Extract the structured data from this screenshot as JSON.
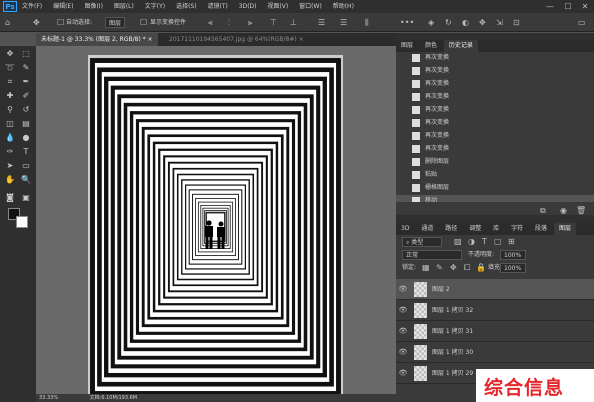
{
  "menubar": {
    "logo": "Ps",
    "items": [
      "文件(F)",
      "编辑(E)",
      "图像(I)",
      "图层(L)",
      "文字(Y)",
      "选择(S)",
      "滤镜(T)",
      "3D(D)",
      "视图(V)",
      "窗口(W)",
      "帮助(H)"
    ],
    "min": "—",
    "max": "☐",
    "close": "✕"
  },
  "options": {
    "auto_select_label": "自动选择:",
    "auto_select_value": "图层",
    "transform_label": "显示变换控件"
  },
  "doc_tabs": [
    {
      "label": "未标题-1 @ 33.3% (图层 2, RGB/8) *  ×",
      "active": true
    },
    {
      "label": "20171110194565407.jpg @ 64%(RGB/8#) ×",
      "active": false
    }
  ],
  "status": {
    "zoom": "33.33%",
    "doc": "文档:6.10M/193.6M"
  },
  "history": {
    "tabs": [
      "图层",
      "颜色",
      "历史记录"
    ],
    "items": [
      "再次变换",
      "再次变换",
      "再次变换",
      "再次变换",
      "再次变换",
      "再次变换",
      "再次变换",
      "再次变换",
      "删除图层",
      "粘贴",
      "栅格图层",
      "移动"
    ]
  },
  "layers": {
    "tabs": [
      "3D",
      "通道",
      "路径",
      "调整",
      "库",
      "字符",
      "段落",
      "图层"
    ],
    "filter_kind": "类型",
    "blend_mode": "正常",
    "opacity_label": "不透明度:",
    "opacity": "100%",
    "lock_label": "锁定:",
    "fill_label": "填充:",
    "fill": "100%",
    "rows": [
      {
        "name": "图层 2",
        "selected": true
      },
      {
        "name": "图层 1 拷贝 32",
        "selected": false
      },
      {
        "name": "图层 1 拷贝 31",
        "selected": false
      },
      {
        "name": "图层 1 拷贝 30",
        "selected": false
      },
      {
        "name": "图层 1 拷贝 29",
        "selected": false
      }
    ]
  },
  "canvas": {
    "frame_count": 27
  },
  "watermark": {
    "text": "综合信息",
    "color": "#e4262c"
  }
}
